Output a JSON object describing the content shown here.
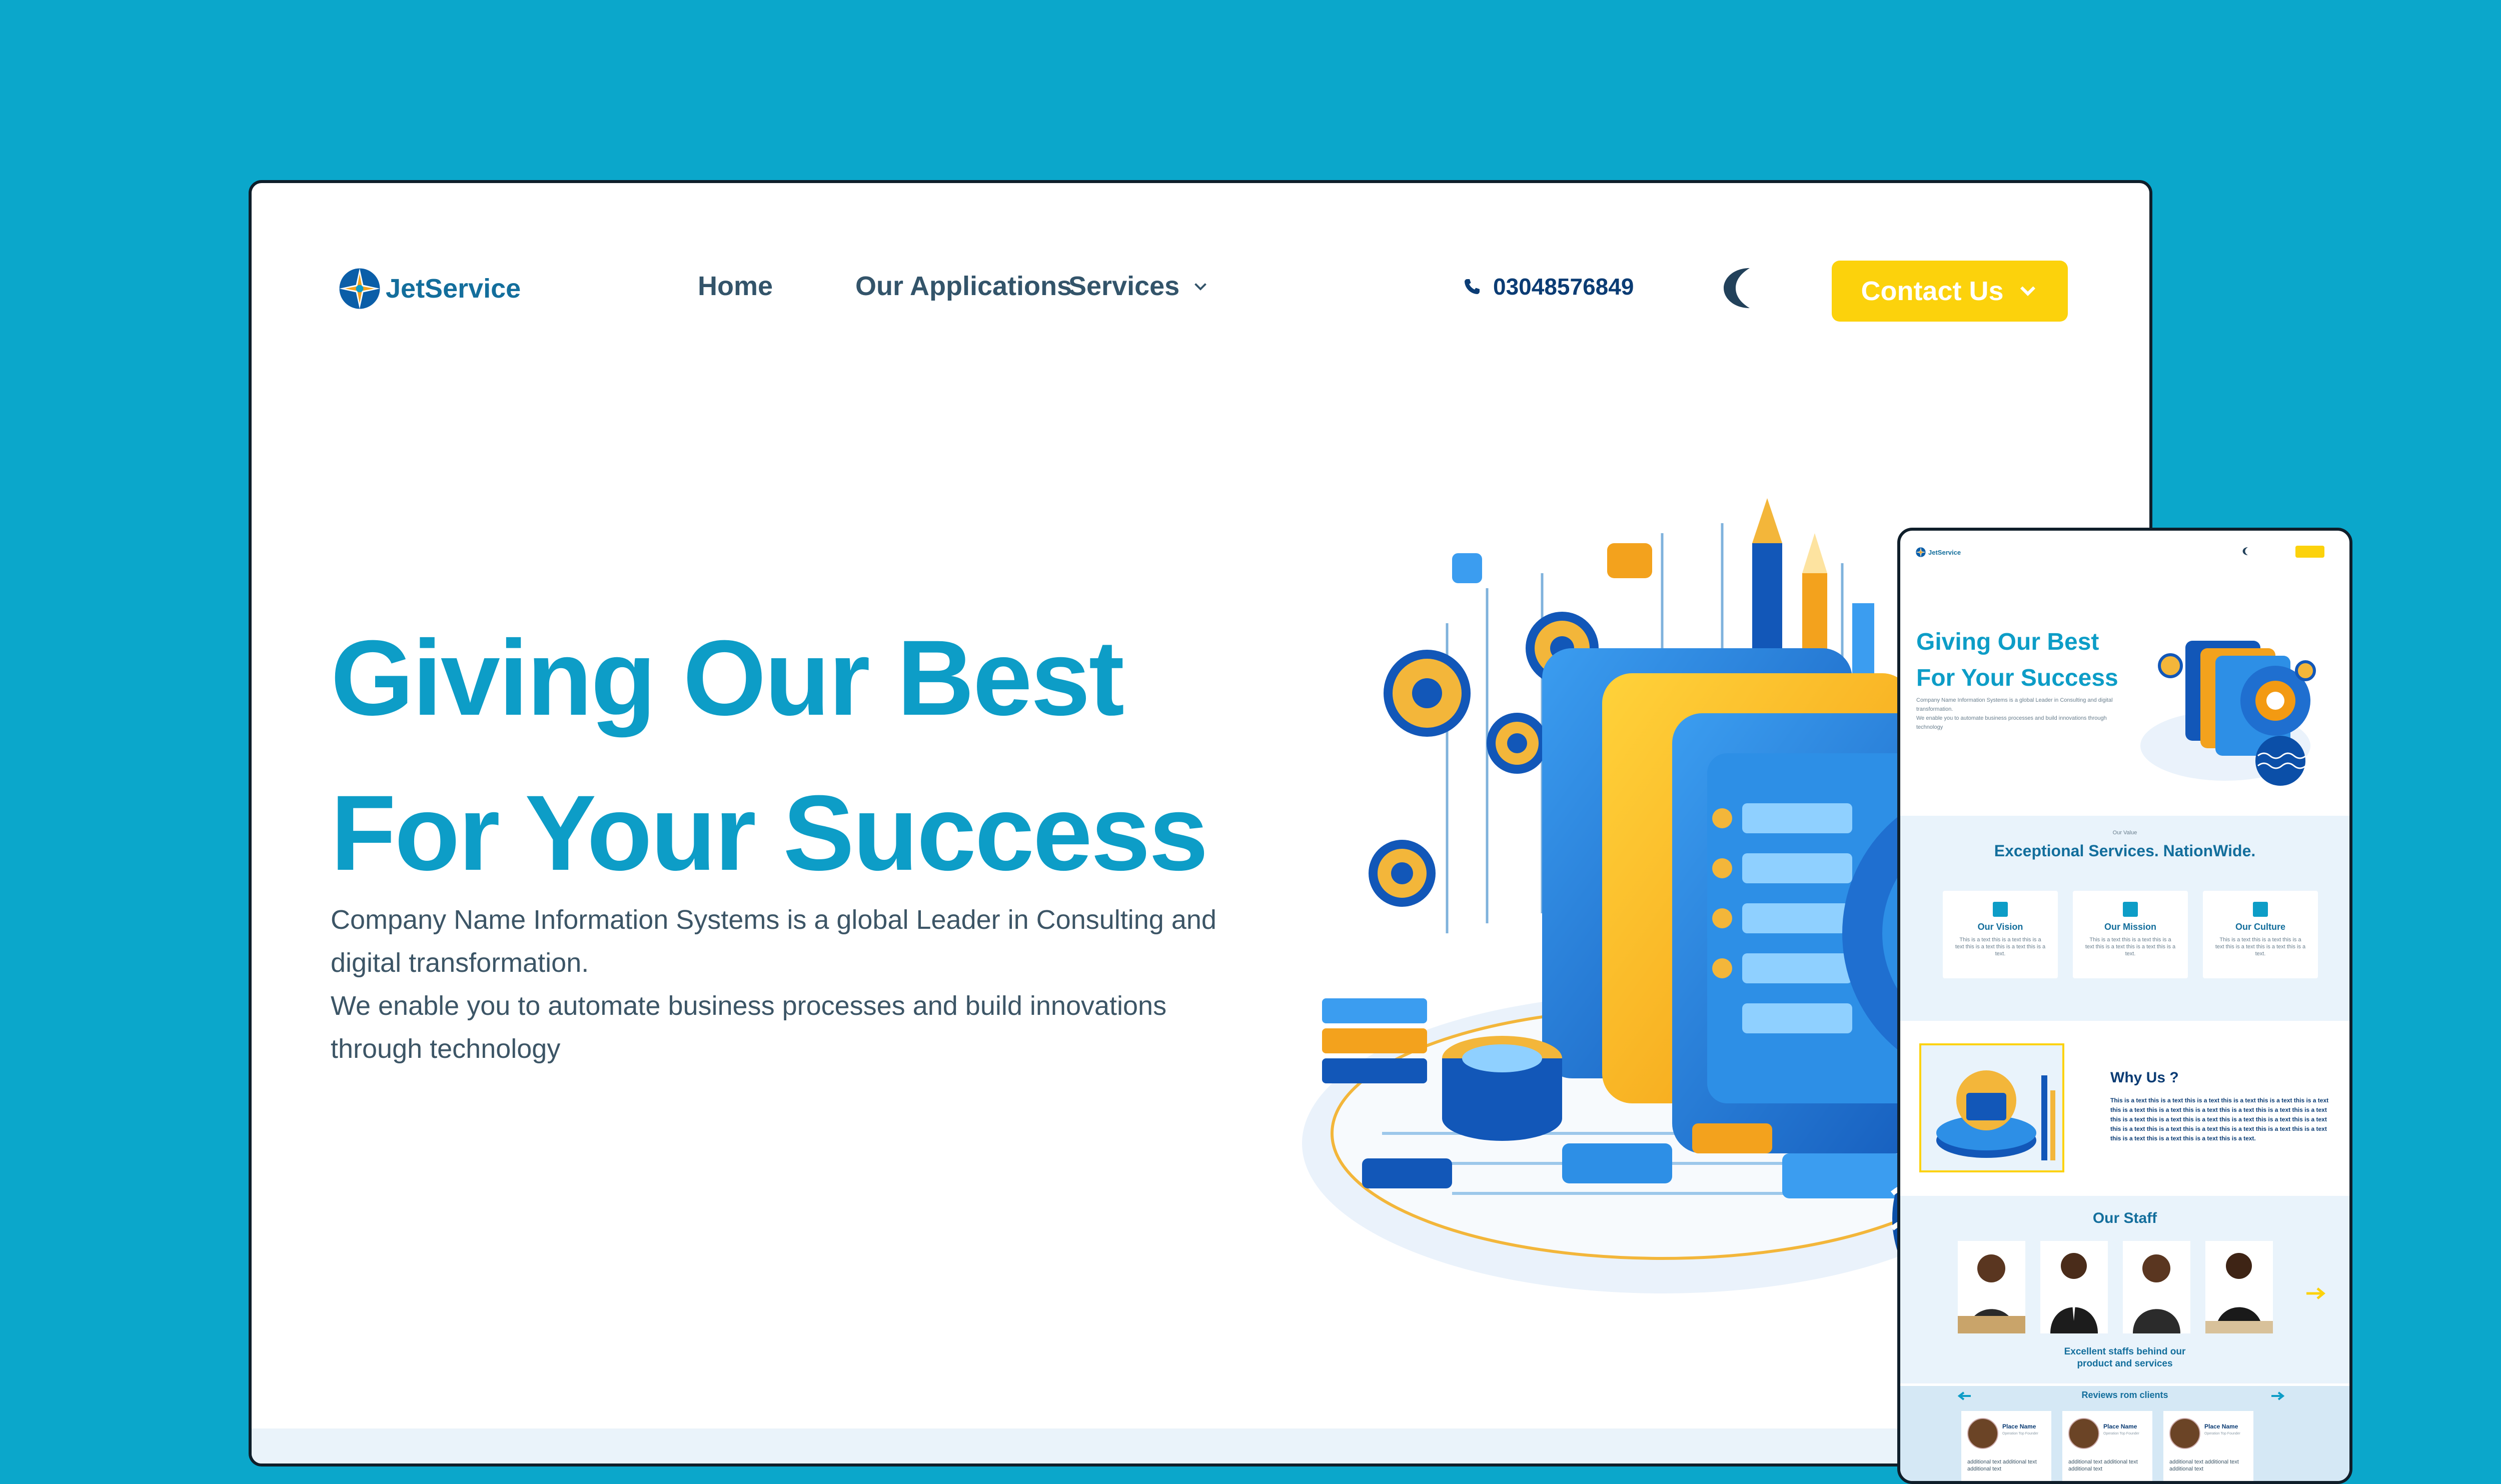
{
  "brand": {
    "name": "JetService"
  },
  "nav": {
    "home": "Home",
    "applications": "Our Applications",
    "services": "Services",
    "phone": "03048576849",
    "contact_label": "Contact Us"
  },
  "hero": {
    "title_line1": "Giving Our Best",
    "title_line2": "For Your Success",
    "desc_line1": "Company Name Information Systems is a global Leader in Consulting and digital transformation.",
    "desc_line2": "We enable you to automate business processes and build innovations through technology"
  },
  "mobile": {
    "brand": "JetService",
    "hero_title_line1": "Giving Our Best",
    "hero_title_line2": "For Your Success",
    "hero_desc_line1": "Company Name Information Systems is a global Leader in Consulting and digital transformation.",
    "hero_desc_line2": "We enable you to automate business processes and build innovations through technology",
    "values": {
      "eyebrow": "Our Value",
      "title": "Exceptional Services. NationWide.",
      "cards": [
        {
          "title": "Our Vision",
          "text": "This is a text this is a text this is a text this is a text this is a text this is a text."
        },
        {
          "title": "Our Mission",
          "text": "This is a text this is a text this is a text this is a text this is a text this is a text."
        },
        {
          "title": "Our Culture",
          "text": "This is a text this is a text this is a text this is a text this is a text this is a text."
        }
      ]
    },
    "why": {
      "title": "Why Us ?",
      "text": "This is a text this is a text this is a text this is a text this is a text this is a text this is a text this is a text this is a text this is a text this is a text this is a text this is a text this is a text this is a text this is a text this is a text this is a text this is a text this is a text this is a text this is a text this is a text this is a text this is a text this is a text this is a text this is a text."
    },
    "staff": {
      "title": "Our Staff",
      "caption_line1": "Excellent staffs behind our",
      "caption_line2": "product and services"
    },
    "reviews": {
      "title": "Reviews rom clients",
      "cards": [
        {
          "name": "Place Name",
          "role": "Operation Top Founder",
          "text": "additional text additional text additional text"
        },
        {
          "name": "Place Name",
          "role": "Operation Top Founder",
          "text": "additional text additional text additional text"
        },
        {
          "name": "Place Name",
          "role": "Operation Top Founder",
          "text": "additional text additional text additional text"
        }
      ]
    }
  },
  "colors": {
    "background": "#0ba7cb",
    "accent": "#0d9dc7",
    "brand_dark": "#0b3c74",
    "cta_yellow": "#fcd20c"
  },
  "icons": [
    "logo-icon",
    "chevron-down-icon",
    "phone-icon",
    "moon-icon",
    "arrow-right-icon",
    "arrow-left-icon"
  ]
}
